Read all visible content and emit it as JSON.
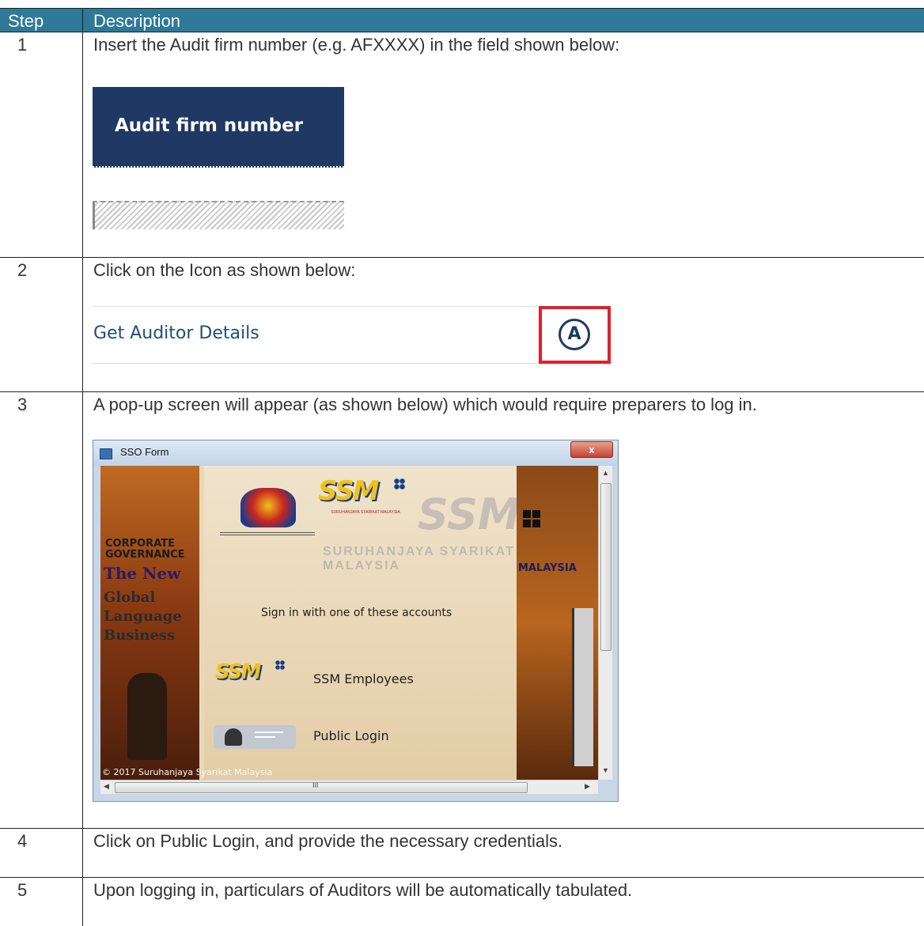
{
  "table": {
    "header": {
      "step": "Step",
      "description": "Description"
    },
    "rows": [
      {
        "step": "1",
        "description": "Insert the Audit firm number (e.g. AFXXXX) in the field shown below:"
      },
      {
        "step": "2",
        "description": "Click on the Icon as shown below:"
      },
      {
        "step": "3",
        "description": "A pop-up screen will appear (as shown below) which would require preparers to log in."
      },
      {
        "step": "4",
        "description": "Click on Public Login, and provide the necessary credentials."
      },
      {
        "step": "5",
        "description": "Upon logging in, particulars of Auditors will be automatically tabulated."
      }
    ]
  },
  "step1_image": {
    "label": "Audit firm number",
    "field_value": ""
  },
  "step2_image": {
    "label": "Get Auditor Details",
    "icon_letter": "A",
    "icon": "auditor-a-circle-icon"
  },
  "sso_window": {
    "title": "SSO Form",
    "close_label": "x",
    "left_panel": {
      "line1": "CORPORATE",
      "line2": "GOVERNANCE",
      "line3": "The New",
      "line4": "Global",
      "line5": "Language",
      "line6": "Business"
    },
    "logo_text": "SSM",
    "logo_caption": "SURUHANJAYA SYARIKAT MALAYSIA",
    "watermark": "SSM",
    "watermark_sub": "SURUHANJAYA SYARIKAT MALAYSIA",
    "right_banner": "MALAYSIA",
    "signin_text": "Sign in with one of these accounts",
    "employees_label": "SSM Employees",
    "public_label": "Public Login",
    "footer": "© 2017 Suruhanjaya Syarikat Malaysia",
    "scroll_grip": "III"
  },
  "colors": {
    "header_bg": "#2e7898",
    "navy": "#1f3864",
    "highlight_red": "#e0202d"
  }
}
